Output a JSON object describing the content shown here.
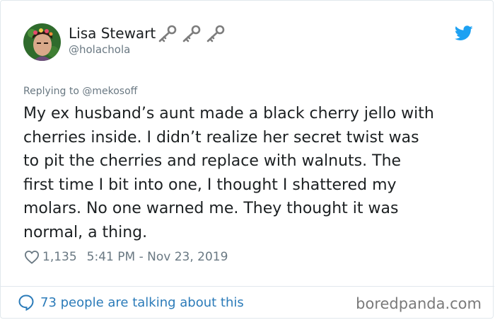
{
  "tweet": {
    "display_name": "Lisa Stewart",
    "name_emoji_icons": [
      "old-key-icon",
      "old-key-icon",
      "old-key-icon"
    ],
    "handle": "@holachola",
    "brand_icon": "twitter-bird-icon",
    "replying_to": "Replying to @mekosoff",
    "text_lines": [
      "My ex husband’s aunt made a black cherry jello with",
      "cherries inside. I didn’t realize her secret twist was",
      "to pit the cherries and replace with walnuts. The",
      "first time I bit into one, I thought I shattered my",
      "molars. No one warned me. They thought it was",
      "normal, a thing."
    ],
    "likes": "1,135",
    "timestamp": "5:41 PM - Nov 23, 2019",
    "talking_about": "73 people are talking about this"
  },
  "watermark": "boredpanda.com",
  "colors": {
    "twitter_blue": "#1da1f2",
    "link_blue": "#2b7bb9",
    "meta_gray": "#697882",
    "text": "#1c2022"
  }
}
